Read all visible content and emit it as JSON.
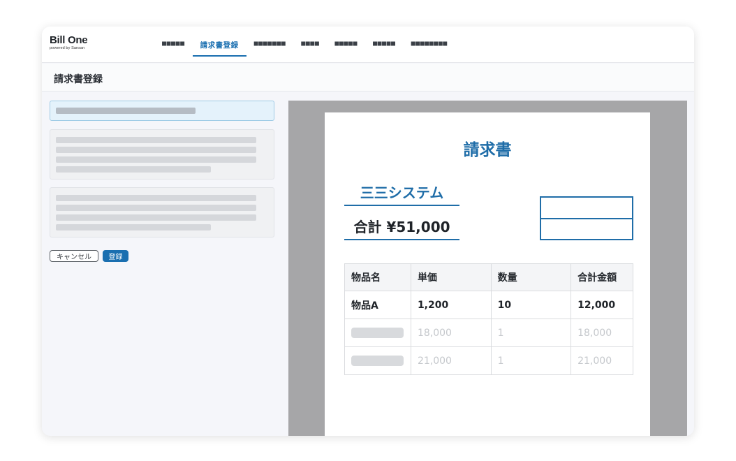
{
  "app": {
    "logo_main": "Bill One",
    "logo_sub": "powered by Sansan"
  },
  "nav": {
    "tabs": [
      {
        "label": "■■■■■",
        "active": false
      },
      {
        "label": "請求書登録",
        "active": true
      },
      {
        "label": "■■■■■■■",
        "active": false
      },
      {
        "label": "■■■■",
        "active": false
      },
      {
        "label": "■■■■■",
        "active": false
      },
      {
        "label": "■■■■■",
        "active": false
      },
      {
        "label": "■■■■■■■■",
        "active": false
      }
    ]
  },
  "page": {
    "title": "請求書登録"
  },
  "form": {
    "cancel_label": "キャンセル",
    "submit_label": "登録"
  },
  "invoice": {
    "title": "請求書",
    "vendor": "三三システム",
    "total": "合計 ¥51,000",
    "columns": [
      "物品名",
      "単価",
      "数量",
      "合計金額"
    ],
    "rows": [
      {
        "name": "物品A",
        "unit_price": "1,200",
        "quantity": "10",
        "amount": "12,000",
        "placeholder": false
      },
      {
        "name": "",
        "unit_price": "18,000",
        "quantity": "1",
        "amount": "18,000",
        "placeholder": true
      },
      {
        "name": "",
        "unit_price": "21,000",
        "quantity": "1",
        "amount": "21,000",
        "placeholder": true
      }
    ]
  },
  "colors": {
    "accent": "#1a6fb0",
    "invoice_blue": "#1f6da8",
    "viewer_bg": "#a6a6a8",
    "field_active_bg": "#e4f2fb"
  }
}
